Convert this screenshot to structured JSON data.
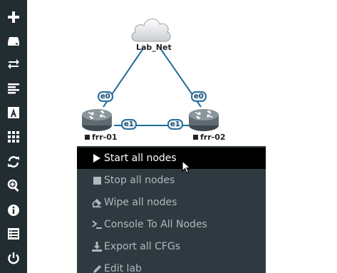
{
  "sidebar": {
    "items": [
      {
        "icon": "plus-icon"
      },
      {
        "icon": "hdd-icon"
      },
      {
        "icon": "exchange-icon"
      },
      {
        "icon": "align-left-icon"
      },
      {
        "icon": "font-icon"
      },
      {
        "icon": "grid-icon"
      },
      {
        "icon": "refresh-icon"
      },
      {
        "icon": "zoom-in-icon"
      },
      {
        "icon": "info-icon"
      },
      {
        "icon": "list-icon"
      },
      {
        "icon": "power-icon"
      }
    ]
  },
  "topology": {
    "cloud": {
      "label": "Lab_Net"
    },
    "nodes": [
      {
        "name": "frr-01"
      },
      {
        "name": "frr-02"
      }
    ],
    "interfaces": {
      "frr01_e0": "e0",
      "frr02_e0": "e0",
      "frr01_e1": "e1",
      "frr02_e1": "e1"
    },
    "colors": {
      "link": "#1f6e99",
      "router": "#5f6b72"
    }
  },
  "context_menu": {
    "items": [
      {
        "label": "Start all nodes",
        "icon": "play-icon"
      },
      {
        "label": "Stop all nodes",
        "icon": "stop-icon"
      },
      {
        "label": "Wipe all nodes",
        "icon": "eraser-icon"
      },
      {
        "label": "Console To All Nodes",
        "icon": "terminal-icon"
      },
      {
        "label": "Export all CFGs",
        "icon": "download-icon"
      },
      {
        "label": "Edit lab",
        "icon": "pencil-icon"
      }
    ]
  },
  "colors": {
    "sidebar_bg": "#222d32",
    "menu_bg": "#2f3a40",
    "menu_active": "#000000"
  }
}
